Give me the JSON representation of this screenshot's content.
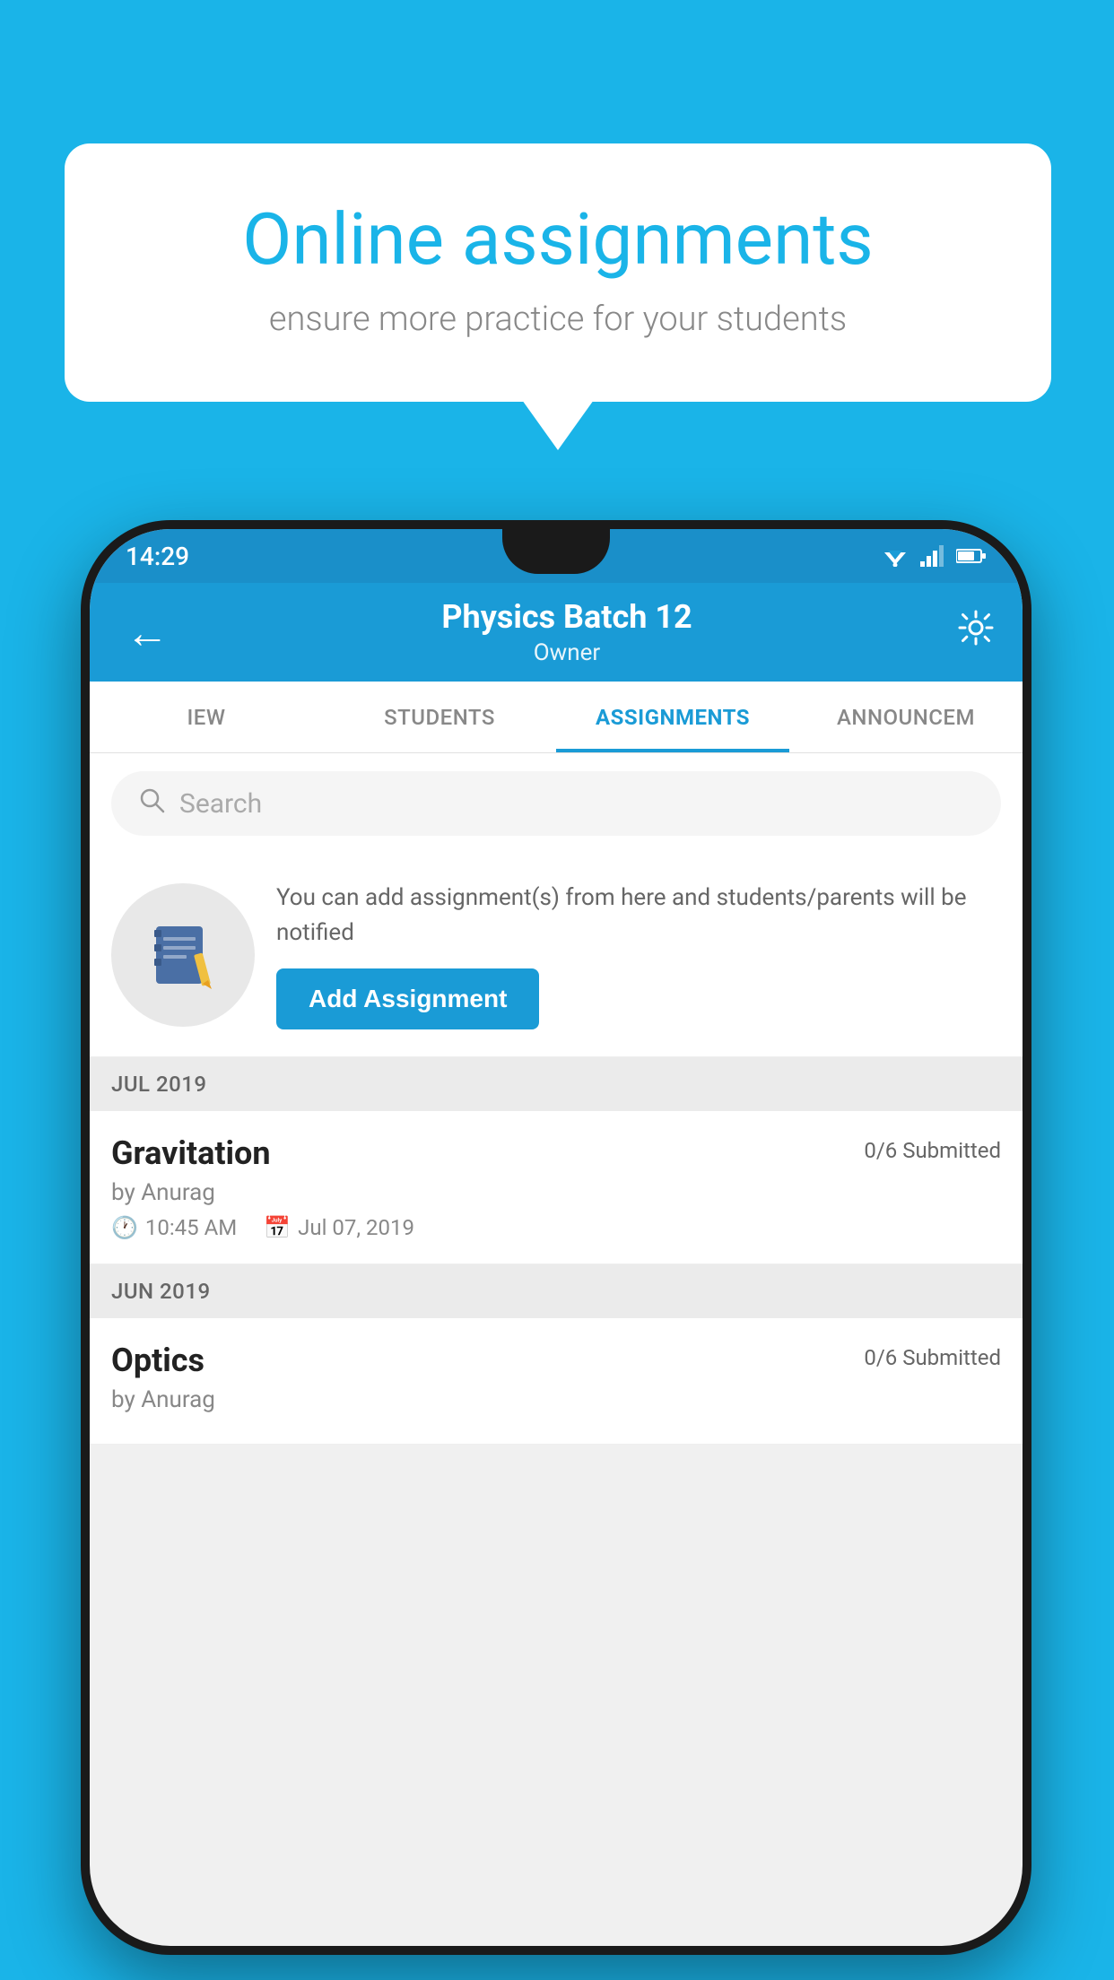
{
  "background_color": "#1ab4e8",
  "speech_bubble": {
    "title": "Online assignments",
    "subtitle": "ensure more practice for your students"
  },
  "phone": {
    "status_bar": {
      "time": "14:29"
    },
    "app_bar": {
      "title": "Physics Batch 12",
      "subtitle": "Owner",
      "back_label": "←",
      "gear_label": "⚙"
    },
    "tabs": [
      {
        "label": "IEW",
        "active": false
      },
      {
        "label": "STUDENTS",
        "active": false
      },
      {
        "label": "ASSIGNMENTS",
        "active": true
      },
      {
        "label": "ANNOUNCEM",
        "active": false
      }
    ],
    "search": {
      "placeholder": "Search"
    },
    "promo": {
      "text": "You can add assignment(s) from here and students/parents will be notified",
      "button_label": "Add Assignment"
    },
    "sections": [
      {
        "header": "JUL 2019",
        "assignments": [
          {
            "name": "Gravitation",
            "submitted": "0/6 Submitted",
            "by": "by Anurag",
            "time": "10:45 AM",
            "date": "Jul 07, 2019"
          }
        ]
      },
      {
        "header": "JUN 2019",
        "assignments": [
          {
            "name": "Optics",
            "submitted": "0/6 Submitted",
            "by": "by Anurag",
            "time": "",
            "date": ""
          }
        ]
      }
    ]
  }
}
